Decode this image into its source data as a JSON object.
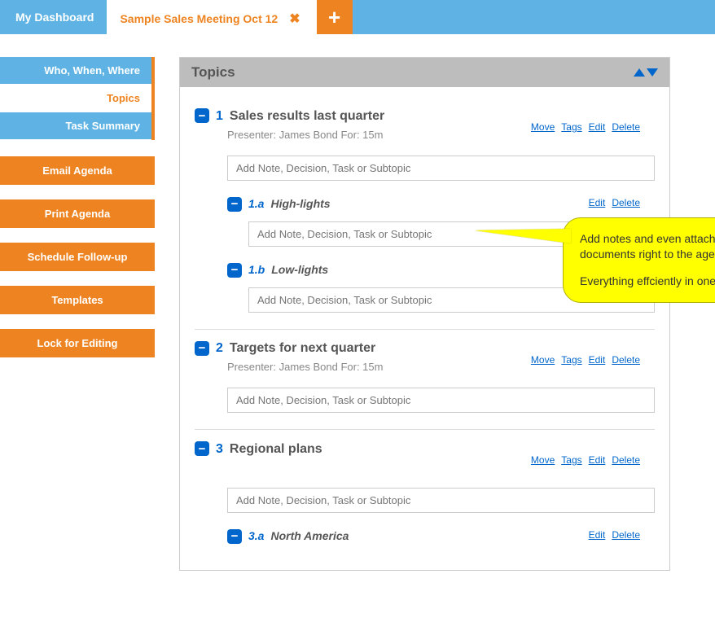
{
  "tabs": {
    "dashboard": "My Dashboard",
    "active": "Sample Sales Meeting Oct 12",
    "add_symbol": "+"
  },
  "sidebar": {
    "nav": [
      {
        "label": "Who, When, Where"
      },
      {
        "label": "Topics"
      },
      {
        "label": "Task Summary"
      }
    ],
    "buttons": [
      {
        "label": "Email Agenda"
      },
      {
        "label": "Print Agenda"
      },
      {
        "label": "Schedule Follow-up"
      },
      {
        "label": "Templates"
      },
      {
        "label": "Lock for Editing"
      }
    ]
  },
  "panel": {
    "title": "Topics",
    "note_placeholder": "Add Note, Decision, Task or Subtopic",
    "actions": {
      "move": "Move",
      "tags": "Tags",
      "edit": "Edit",
      "delete": "Delete"
    },
    "topics": [
      {
        "num": "1",
        "title": "Sales results last quarter",
        "presenter": "Presenter: James Bond For: 15m",
        "subs": [
          {
            "num": "1.a",
            "title": "High-lights"
          },
          {
            "num": "1.b",
            "title": "Low-lights"
          }
        ]
      },
      {
        "num": "2",
        "title": "Targets for next quarter",
        "presenter": "Presenter: James Bond For: 15m",
        "subs": []
      },
      {
        "num": "3",
        "title": "Regional plans",
        "presenter": "",
        "subs": [
          {
            "num": "3.a",
            "title": "North America"
          }
        ]
      }
    ]
  },
  "callout": {
    "p1": "Add notes and even attach documents right to the agenda.",
    "p2": "Everything effciently in one place."
  }
}
